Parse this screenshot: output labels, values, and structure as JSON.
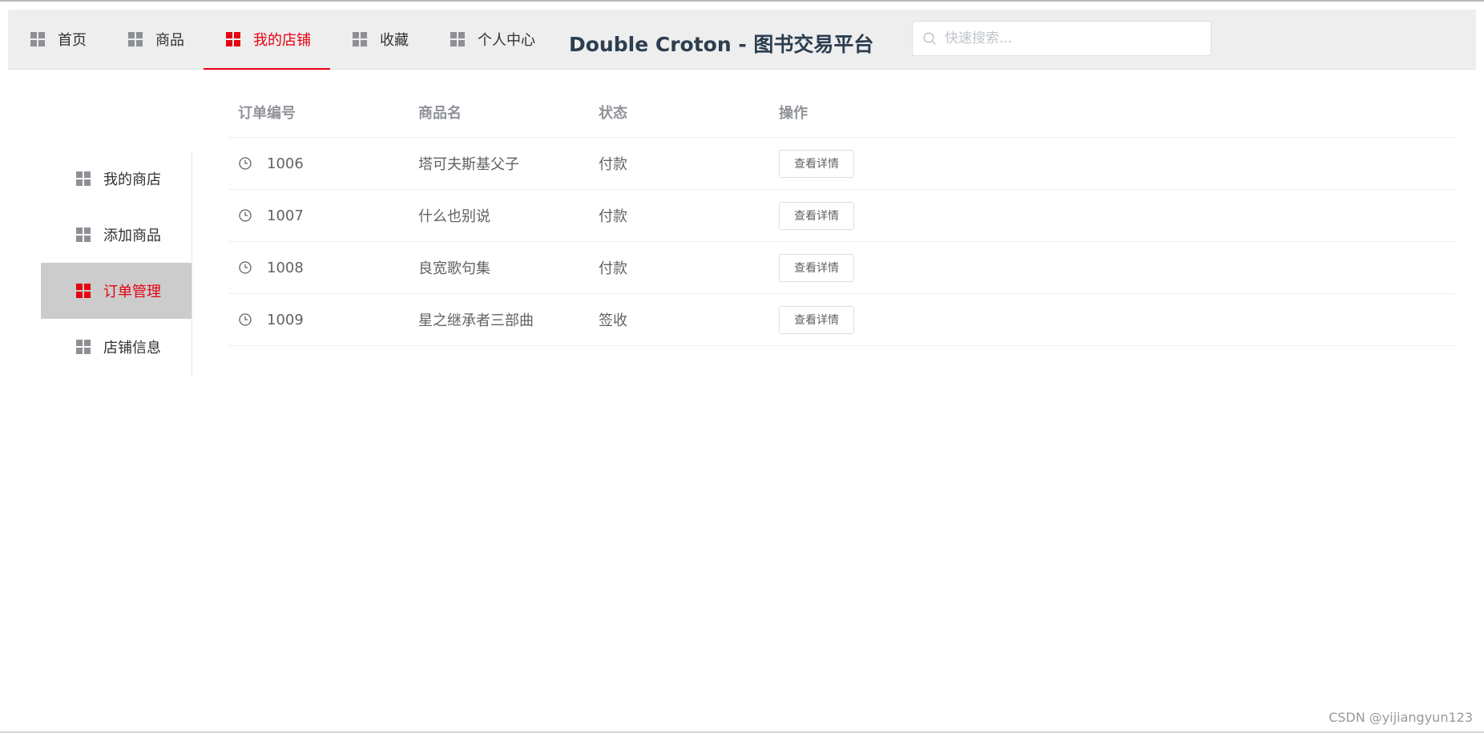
{
  "header": {
    "nav": [
      {
        "label": "首页",
        "icon": "grid-icon",
        "active": false
      },
      {
        "label": "商品",
        "icon": "grid-icon",
        "active": false
      },
      {
        "label": "我的店铺",
        "icon": "grid-icon",
        "active": true
      },
      {
        "label": "收藏",
        "icon": "grid-icon",
        "active": false
      },
      {
        "label": "个人中心",
        "icon": "grid-icon",
        "active": false
      }
    ],
    "title": "Double Croton - 图书交易平台",
    "search": {
      "placeholder": "快速搜索...",
      "value": "",
      "icon": "search-icon"
    }
  },
  "sidebar": {
    "items": [
      {
        "label": "我的商店",
        "icon": "grid-icon",
        "active": false
      },
      {
        "label": "添加商品",
        "icon": "grid-icon",
        "active": false
      },
      {
        "label": "订单管理",
        "icon": "grid-icon",
        "active": true
      },
      {
        "label": "店铺信息",
        "icon": "grid-icon",
        "active": false
      }
    ]
  },
  "orders": {
    "columns": [
      "订单编号",
      "商品名",
      "状态",
      "操作"
    ],
    "rows": [
      {
        "id": "1006",
        "name": "塔可夫斯基父子",
        "status": "付款",
        "action": "查看详情",
        "icon": "clock-icon"
      },
      {
        "id": "1007",
        "name": "什么也别说",
        "status": "付款",
        "action": "查看详情",
        "icon": "clock-icon"
      },
      {
        "id": "1008",
        "name": "良宽歌句集",
        "status": "付款",
        "action": "查看详情",
        "icon": "clock-icon"
      },
      {
        "id": "1009",
        "name": "星之继承者三部曲",
        "status": "签收",
        "action": "查看详情",
        "icon": "clock-icon"
      }
    ]
  },
  "watermark": "CSDN @yijiangyun123",
  "colors": {
    "accent": "#e60012",
    "header_bg": "#eeeeee",
    "active_side_bg": "#cccccc",
    "icon_gray": "#8e9096"
  }
}
